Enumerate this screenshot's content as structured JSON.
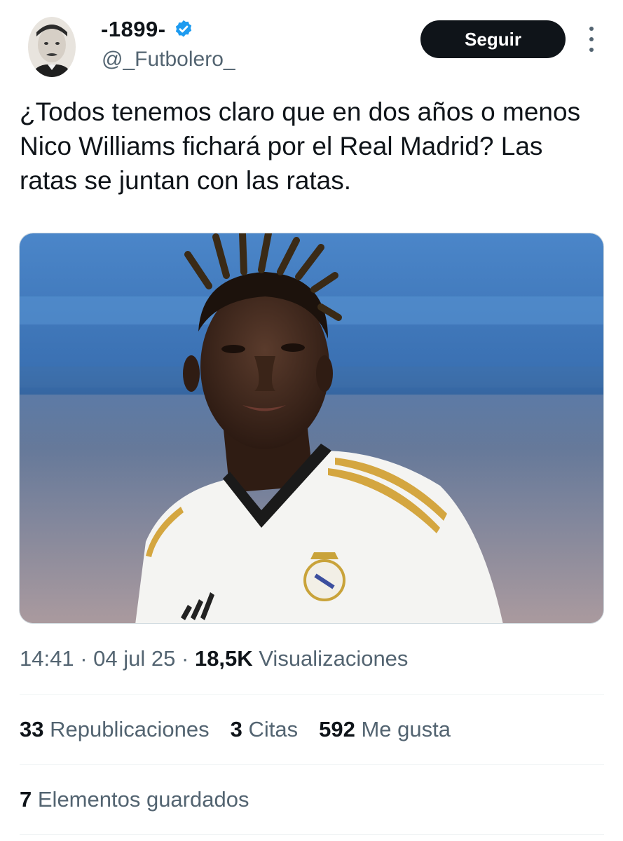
{
  "author": {
    "display_name": "-1899-",
    "handle": "@_Futbolero_",
    "verified_icon": "verified-badge-icon",
    "avatar_icon": "vintage-portrait-avatar"
  },
  "follow_button": {
    "label": "Seguir"
  },
  "more_menu": {
    "icon": "more-vertical-icon"
  },
  "tweet": {
    "text": "¿Todos tenemos claro que en dos años o menos Nico Williams fichará por el Real Madrid? Las ratas se juntan con las ratas.",
    "image_icon": "player-photo-image"
  },
  "meta": {
    "time": "14:41",
    "sep1": "·",
    "date": "04 jul 25",
    "sep2": "·",
    "views_count": "18,5K",
    "views_label": "Visualizaciones"
  },
  "stats": {
    "reposts_count": "33",
    "reposts_label": "Republicaciones",
    "quotes_count": "3",
    "quotes_label": "Citas",
    "likes_count": "592",
    "likes_label": "Me gusta"
  },
  "bookmarks": {
    "count": "7",
    "label": "Elementos guardados"
  },
  "colors": {
    "text_primary": "#0f1419",
    "text_secondary": "#536471",
    "verified_blue": "#1d9bf0",
    "button_bg": "#0f1419",
    "divider": "#eff3f4"
  }
}
